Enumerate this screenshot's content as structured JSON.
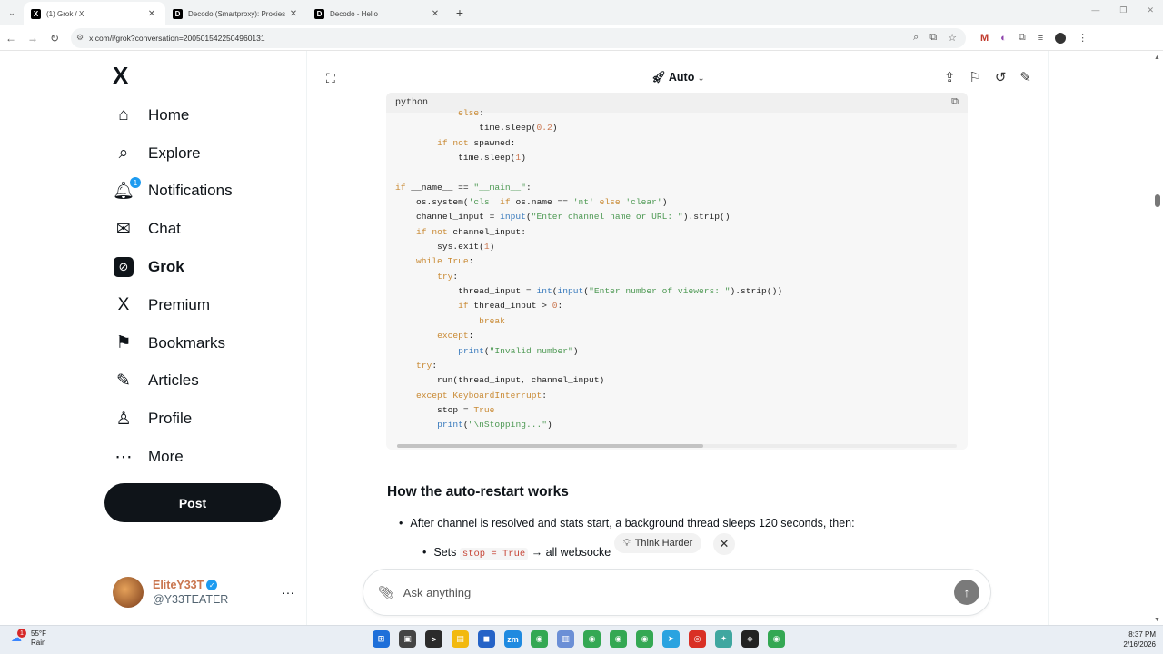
{
  "browser": {
    "tabs": [
      {
        "title": "(1) Grok / X",
        "active": true
      },
      {
        "title": "Decodo (Smartproxy): Proxies &",
        "active": false
      },
      {
        "title": "Decodo - Hello",
        "active": false
      }
    ],
    "url": "x.com/i/grok?conversation=2005015422504960131"
  },
  "sidebar": {
    "logo": "X",
    "items": [
      {
        "label": "Home",
        "icon": "home-icon"
      },
      {
        "label": "Explore",
        "icon": "search-icon"
      },
      {
        "label": "Notifications",
        "icon": "bell-icon",
        "badge": "1"
      },
      {
        "label": "Chat",
        "icon": "mail-icon"
      },
      {
        "label": "Grok",
        "icon": "grok-icon"
      },
      {
        "label": "Premium",
        "icon": "x-icon"
      },
      {
        "label": "Bookmarks",
        "icon": "bookmark-icon"
      },
      {
        "label": "Articles",
        "icon": "article-icon"
      },
      {
        "label": "Profile",
        "icon": "person-icon"
      },
      {
        "label": "More",
        "icon": "more-icon"
      }
    ],
    "post_label": "Post",
    "user": {
      "name": "EliteY33T",
      "handle": "@Y33TEATER"
    }
  },
  "main": {
    "mode_label": "Auto",
    "code_lang": "python",
    "code_lines": [
      "            else:",
      "                time.sleep(0.2)",
      "        if not spawned:",
      "            time.sleep(1)",
      "",
      "if __name__ == \"__main__\":",
      "    os.system('cls' if os.name == 'nt' else 'clear')",
      "    channel_input = input(\"Enter channel name or URL: \").strip()",
      "    if not channel_input:",
      "        sys.exit(1)",
      "    while True:",
      "        try:",
      "            thread_input = int(input(\"Enter number of viewers: \").strip())",
      "            if thread_input > 0:",
      "                break",
      "        except:",
      "            print(\"Invalid number\")",
      "    try:",
      "        run(thread_input, channel_input)",
      "    except KeyboardInterrupt:",
      "        stop = True",
      "        print(\"\\nStopping...\")"
    ],
    "section_heading": "How the auto-restart works",
    "bullet1": "After channel is resolved and stats start, a background thread sleeps 120 seconds, then:",
    "bullet2_prefix": "Sets",
    "bullet2_code": "stop = True",
    "bullet2_suffix": "→ all websocke",
    "think_harder": "Think Harder",
    "ask_placeholder": "Ask anything"
  },
  "taskbar": {
    "temp": "55°F",
    "condition": "Rain",
    "weather_badge": "1",
    "time": "8:37 PM",
    "date": "2/16/2026"
  }
}
